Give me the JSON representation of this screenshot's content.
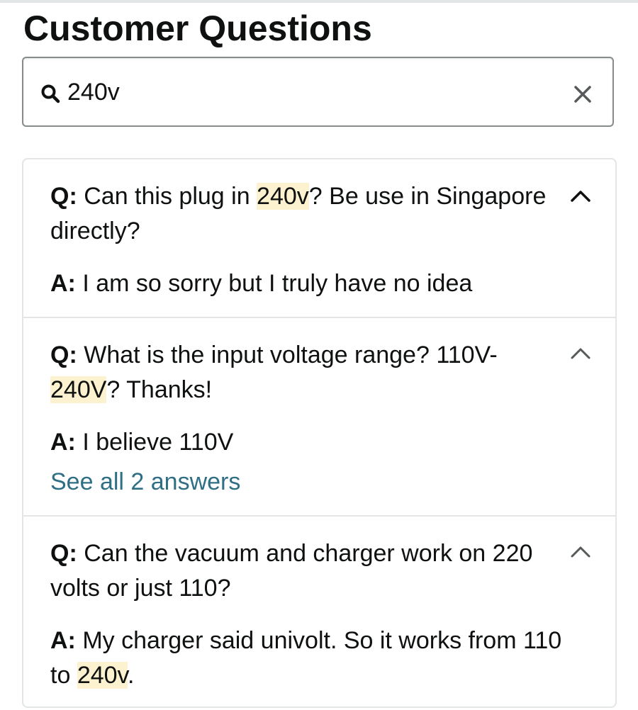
{
  "page": {
    "title": "Customer Questions"
  },
  "search": {
    "value": "240v",
    "icon": "search-icon",
    "clear_icon": "close-icon"
  },
  "colors": {
    "highlight": "#fcf2cf",
    "link": "#2f6f85",
    "border": "#e3e6e6"
  },
  "qa": [
    {
      "q_prefix": "Q:",
      "question_parts": [
        "Can this plug in ",
        "240v",
        "? Be use in Singapore directly?"
      ],
      "a_prefix": "A:",
      "answer_parts": [
        "I am so sorry but I truly have no idea"
      ],
      "chevron": "chevron-up-icon"
    },
    {
      "q_prefix": "Q:",
      "question_parts": [
        "What is the input voltage range? 110V-",
        "240V",
        "? Thanks!"
      ],
      "a_prefix": "A:",
      "answer_parts": [
        "I believe 110V"
      ],
      "see_all": "See all 2 answers",
      "chevron": "chevron-up-icon"
    },
    {
      "q_prefix": "Q:",
      "question_parts": [
        "Can the vacuum and charger work on 220 volts or just 110?"
      ],
      "a_prefix": "A:",
      "answer_parts": [
        "My charger said univolt. So it works from 110 to ",
        "240v",
        "."
      ],
      "chevron": "chevron-up-icon"
    }
  ]
}
